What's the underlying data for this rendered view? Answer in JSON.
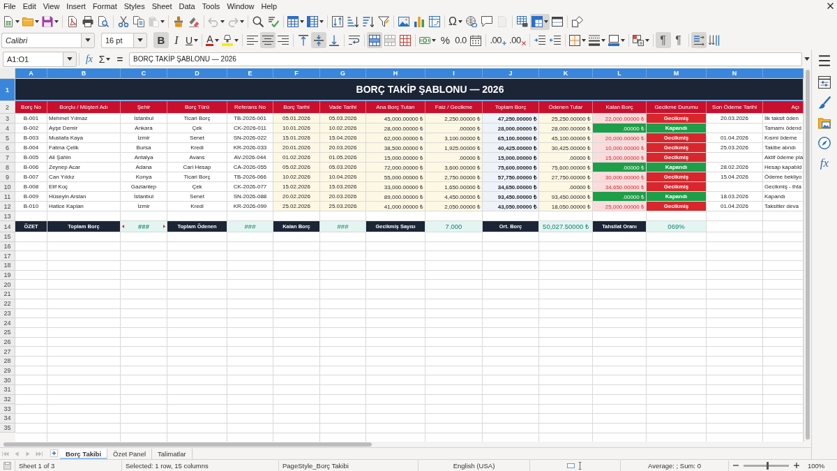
{
  "menu_bar": [
    "File",
    "Edit",
    "View",
    "Insert",
    "Format",
    "Styles",
    "Sheet",
    "Data",
    "Tools",
    "Window",
    "Help"
  ],
  "standard_toolbar": [
    [
      {
        "kind": "new",
        "dropdown": true,
        "disabled": false,
        "on": false
      },
      {
        "kind": "open",
        "dropdown": true,
        "disabled": false,
        "on": false
      },
      {
        "kind": "save",
        "dropdown": true,
        "disabled": false,
        "on": false
      }
    ],
    [
      {
        "kind": "export_pdf",
        "dropdown": false,
        "disabled": false,
        "on": false
      },
      {
        "kind": "print",
        "dropdown": false,
        "disabled": false,
        "on": false
      },
      {
        "kind": "print_preview",
        "dropdown": false,
        "disabled": false,
        "on": false
      }
    ],
    [
      {
        "kind": "cut",
        "dropdown": false,
        "disabled": false,
        "on": false
      },
      {
        "kind": "copy",
        "dropdown": false,
        "disabled": false,
        "on": false
      },
      {
        "kind": "paste",
        "dropdown": true,
        "disabled": true,
        "on": false
      }
    ],
    [
      {
        "kind": "clone_formatting",
        "dropdown": false,
        "disabled": false,
        "on": false
      },
      {
        "kind": "clear_formatting",
        "dropdown": false,
        "disabled": false,
        "on": false
      }
    ],
    [
      {
        "kind": "undo",
        "dropdown": true,
        "disabled": true,
        "on": false
      },
      {
        "kind": "redo",
        "dropdown": true,
        "disabled": true,
        "on": false
      }
    ],
    [
      {
        "kind": "find_replace",
        "dropdown": false,
        "disabled": false,
        "on": false
      },
      {
        "kind": "spelling",
        "dropdown": false,
        "disabled": false,
        "on": false
      }
    ],
    [
      {
        "kind": "rows",
        "dropdown": true,
        "disabled": false,
        "on": false
      },
      {
        "kind": "columns",
        "dropdown": true,
        "disabled": false,
        "on": false
      }
    ],
    [
      {
        "kind": "sort",
        "dropdown": false,
        "disabled": false,
        "on": false
      },
      {
        "kind": "sort_ascending",
        "dropdown": false,
        "disabled": false,
        "on": false
      },
      {
        "kind": "sort_descending",
        "dropdown": false,
        "disabled": false,
        "on": false
      },
      {
        "kind": "autofilter",
        "dropdown": false,
        "disabled": false,
        "on": false
      }
    ],
    [
      {
        "kind": "image",
        "dropdown": false,
        "disabled": false,
        "on": false
      },
      {
        "kind": "chart",
        "dropdown": false,
        "disabled": false,
        "on": false
      },
      {
        "kind": "pivot_table",
        "dropdown": false,
        "disabled": false,
        "on": false
      }
    ],
    [
      {
        "kind": "special_character",
        "label": "Ω",
        "dropdown": true,
        "disabled": false,
        "on": false
      },
      {
        "kind": "hyperlink",
        "dropdown": false,
        "disabled": false,
        "on": false
      },
      {
        "kind": "comment",
        "dropdown": false,
        "disabled": false,
        "on": false
      },
      {
        "kind": "header_footer",
        "dropdown": false,
        "disabled": true,
        "on": false
      }
    ],
    [
      {
        "kind": "print_area",
        "dropdown": false,
        "disabled": false,
        "on": false
      },
      {
        "kind": "freeze",
        "dropdown": true,
        "disabled": false,
        "on": true
      },
      {
        "kind": "split_window",
        "dropdown": false,
        "disabled": false,
        "on": false
      }
    ],
    [
      {
        "kind": "shapes",
        "dropdown": false,
        "disabled": false,
        "on": false
      }
    ]
  ],
  "formatting_toolbar": {
    "font_name": "Calibri",
    "font_size": "16 pt",
    "groups": [
      [
        {
          "kind": "bold",
          "label": "B",
          "on": true,
          "dropdown": false
        },
        {
          "kind": "italic",
          "label": "I",
          "on": false,
          "dropdown": false
        },
        {
          "kind": "underline",
          "label": "U",
          "on": false,
          "dropdown": true
        }
      ],
      [
        {
          "kind": "font_color",
          "label": "A",
          "on": false,
          "dropdown": true
        },
        {
          "kind": "highlight",
          "on": false,
          "dropdown": true
        }
      ],
      [
        {
          "kind": "align_left",
          "on": false,
          "dropdown": false
        },
        {
          "kind": "align_center",
          "on": true,
          "dropdown": false
        },
        {
          "kind": "align_right",
          "on": false,
          "dropdown": false
        }
      ],
      [
        {
          "kind": "align_top",
          "on": false,
          "dropdown": false
        },
        {
          "kind": "align_middle",
          "on": true,
          "dropdown": false
        },
        {
          "kind": "align_bottom",
          "on": false,
          "dropdown": false
        }
      ],
      [
        {
          "kind": "wrap_text",
          "on": false,
          "dropdown": false
        }
      ],
      [
        {
          "kind": "merge_center",
          "on": true,
          "dropdown": false
        },
        {
          "kind": "merge_cells",
          "on": false,
          "dropdown": false
        },
        {
          "kind": "unmerge_cells",
          "on": false,
          "dropdown": false
        }
      ],
      [
        {
          "kind": "currency",
          "on": false,
          "dropdown": true
        },
        {
          "kind": "percent",
          "label": "%",
          "on": false,
          "dropdown": false
        },
        {
          "kind": "number",
          "label": "0.0",
          "on": false,
          "dropdown": false
        },
        {
          "kind": "date",
          "on": false,
          "dropdown": false
        }
      ],
      [
        {
          "kind": "add_decimal",
          "label": ".00",
          "on": false,
          "dropdown": false
        },
        {
          "kind": "delete_decimal",
          "label": ".00",
          "on": false,
          "dropdown": false
        }
      ],
      [
        {
          "kind": "increase_indent",
          "on": false,
          "dropdown": false
        },
        {
          "kind": "decrease_indent",
          "on": false,
          "dropdown": false
        }
      ],
      [
        {
          "kind": "borders",
          "on": false,
          "dropdown": true
        },
        {
          "kind": "border_style",
          "on": false,
          "dropdown": true
        },
        {
          "kind": "border_color",
          "on": false,
          "dropdown": true
        }
      ],
      [
        {
          "kind": "conditional",
          "on": false,
          "dropdown": true
        }
      ],
      [
        {
          "kind": "ltr",
          "label": "¶",
          "on": true,
          "dropdown": false
        },
        {
          "kind": "rtl",
          "label": "¶",
          "on": false,
          "dropdown": false
        }
      ],
      [
        {
          "kind": "text_ltr",
          "on": true,
          "dropdown": false
        },
        {
          "kind": "text_ttb",
          "on": false,
          "dropdown": false
        }
      ]
    ]
  },
  "formula_bar": {
    "name_box": "A1:O1",
    "function_wizard": "fx",
    "sum": "Σ",
    "formula": "=",
    "content": "BORÇ TAKİP ŞABLONU — 2026"
  },
  "sidebar": [
    {
      "kind": "menu"
    },
    {
      "kind": "properties"
    },
    {
      "kind": "styles"
    },
    {
      "kind": "gallery"
    },
    {
      "kind": "navigator"
    },
    {
      "kind": "functions",
      "label": "fx"
    }
  ],
  "sheet": {
    "column_letters": [
      {
        "label": "A",
        "selected": true
      },
      {
        "label": "B",
        "selected": true
      },
      {
        "label": "C",
        "selected": true
      },
      {
        "label": "D",
        "selected": true
      },
      {
        "label": "E",
        "selected": true
      },
      {
        "label": "F",
        "selected": true
      },
      {
        "label": "G",
        "selected": true
      },
      {
        "label": "H",
        "selected": true
      },
      {
        "label": "I",
        "selected": true
      },
      {
        "label": "J",
        "selected": true
      },
      {
        "label": "K",
        "selected": true
      },
      {
        "label": "L",
        "selected": true
      },
      {
        "label": "M",
        "selected": true
      },
      {
        "label": "N",
        "selected": true
      },
      {
        "selected": true
      }
    ],
    "row_numbers": [
      {
        "label": "1",
        "selected": true
      },
      {
        "label": "2",
        "selected": false
      },
      {
        "label": "3",
        "selected": false
      },
      {
        "label": "4",
        "selected": false
      },
      {
        "label": "5",
        "selected": false
      },
      {
        "label": "6",
        "selected": false
      },
      {
        "label": "7",
        "selected": false
      },
      {
        "label": "8",
        "selected": false
      },
      {
        "label": "9",
        "selected": false
      },
      {
        "label": "10",
        "selected": false
      },
      {
        "label": "11",
        "selected": false
      },
      {
        "label": "12",
        "selected": false
      },
      {
        "label": "13",
        "selected": false
      },
      {
        "label": "14",
        "selected": false
      },
      {
        "label": "15",
        "selected": false
      },
      {
        "label": "16",
        "selected": false
      },
      {
        "label": "17",
        "selected": false
      },
      {
        "label": "18",
        "selected": false
      },
      {
        "label": "19",
        "selected": false
      },
      {
        "label": "20",
        "selected": false
      },
      {
        "label": "21",
        "selected": false
      },
      {
        "label": "22",
        "selected": false
      },
      {
        "label": "23",
        "selected": false
      },
      {
        "label": "24",
        "selected": false
      },
      {
        "label": "25",
        "selected": false
      },
      {
        "label": "26",
        "selected": false
      },
      {
        "label": "27",
        "selected": false
      },
      {
        "label": "28",
        "selected": false
      },
      {
        "label": "29",
        "selected": false
      },
      {
        "label": "30",
        "selected": false
      },
      {
        "label": "31",
        "selected": false
      },
      {
        "label": "32",
        "selected": false
      },
      {
        "label": "33",
        "selected": false
      },
      {
        "label": "34",
        "selected": false
      },
      {
        "label": "35",
        "selected": false
      }
    ],
    "title": "BORÇ TAKİP ŞABLONU — 2026",
    "headers": [
      "Borç No",
      "Borçlu / Müşteri Adı",
      "Şehir",
      "Borç Türü",
      "Referans No",
      "Borç Tarihi",
      "Vade Tarihi",
      "Ana Borç Tutarı",
      "Faiz / Gecikme",
      "Toplam Borç",
      "Ödenen Tutar",
      "Kalan Borç",
      "Gecikme Durumu",
      "Son Ödeme Tarihi",
      "Açı"
    ],
    "rows": [
      {
        "no": "B-001",
        "debtor": "Mehmet Yılmaz",
        "city": "İstanbul",
        "type": "Ticari Borç",
        "reference": "TB-2026-001",
        "debt_date": "05.01.2026",
        "due_date": "05.03.2026",
        "principal": "45,000.00000 ₺",
        "interest": "2,250.00000 ₺",
        "total": "47,250.00000 ₺",
        "paid": "25,250.00000 ₺",
        "remaining": "22,000.00000 ₺",
        "status": "Gecikmiş",
        "kind": "overdue",
        "last_payment": "20.03.2026",
        "note": "İlk taksit öden"
      },
      {
        "no": "B-002",
        "debtor": "Ayşe Demir",
        "city": "Ankara",
        "type": "Çek",
        "reference": "CK-2026-011",
        "debt_date": "10.01.2026",
        "due_date": "10.02.2026",
        "principal": "28,000.00000 ₺",
        "interest": ".00000 ₺",
        "total": "28,000.00000 ₺",
        "paid": "28,000.00000 ₺",
        "remaining": ".00000 ₺",
        "status": "Kapandı",
        "kind": "closed",
        "note": "Tamamı ödend"
      },
      {
        "no": "B-003",
        "debtor": "Mustafa Kaya",
        "city": "İzmir",
        "type": "Senet",
        "reference": "SN-2026-022",
        "debt_date": "15.01.2026",
        "due_date": "15.04.2026",
        "principal": "62,000.00000 ₺",
        "interest": "3,100.00000 ₺",
        "total": "65,100.00000 ₺",
        "paid": "45,100.00000 ₺",
        "remaining": "20,000.00000 ₺",
        "status": "Gecikmiş",
        "kind": "overdue",
        "last_payment": "01.04.2026",
        "note": "Kısmi ödeme"
      },
      {
        "no": "B-004",
        "debtor": "Fatma Çelik",
        "city": "Bursa",
        "type": "Kredi",
        "reference": "KR-2026-033",
        "debt_date": "20.01.2026",
        "due_date": "20.03.2026",
        "principal": "38,500.00000 ₺",
        "interest": "1,925.00000 ₺",
        "total": "40,425.00000 ₺",
        "paid": "30,425.00000 ₺",
        "remaining": "10,000.00000 ₺",
        "status": "Gecikmiş",
        "kind": "overdue",
        "last_payment": "25.03.2026",
        "note": "Takibe alındı"
      },
      {
        "no": "B-005",
        "debtor": "Ali Şahin",
        "city": "Antalya",
        "type": "Avans",
        "reference": "AV-2026-044",
        "debt_date": "01.02.2026",
        "due_date": "01.05.2026",
        "principal": "15,000.00000 ₺",
        "interest": ".00000 ₺",
        "total": "15,000.00000 ₺",
        "paid": ".00000 ₺",
        "remaining": "15,000.00000 ₺",
        "status": "Gecikmiş",
        "kind": "overdue",
        "note": "Aktif ödeme pla"
      },
      {
        "no": "B-006",
        "debtor": "Zeynep Acar",
        "city": "Adana",
        "type": "Cari Hesap",
        "reference": "CA-2026-055",
        "debt_date": "05.02.2026",
        "due_date": "05.03.2026",
        "principal": "72,000.00000 ₺",
        "interest": "3,600.00000 ₺",
        "total": "75,600.00000 ₺",
        "paid": "75,600.00000 ₺",
        "remaining": ".00000 ₺",
        "status": "Kapandı",
        "kind": "closed",
        "last_payment": "28.02.2026",
        "note": "Hesap kapatıld"
      },
      {
        "no": "B-007",
        "debtor": "Can Yıldız",
        "city": "Konya",
        "type": "Ticari Borç",
        "reference": "TB-2026-066",
        "debt_date": "10.02.2026",
        "due_date": "10.04.2026",
        "principal": "55,000.00000 ₺",
        "interest": "2,750.00000 ₺",
        "total": "57,750.00000 ₺",
        "paid": "27,750.00000 ₺",
        "remaining": "30,000.00000 ₺",
        "status": "Gecikmiş",
        "kind": "overdue",
        "last_payment": "15.04.2026",
        "note": "Ödeme bekliyo"
      },
      {
        "no": "B-008",
        "debtor": "Elif Koç",
        "city": "Gaziantep",
        "type": "Çek",
        "reference": "CK-2026-077",
        "debt_date": "15.02.2026",
        "due_date": "15.03.2026",
        "principal": "33,000.00000 ₺",
        "interest": "1,650.00000 ₺",
        "total": "34,650.00000 ₺",
        "paid": ".00000 ₺",
        "remaining": "34,650.00000 ₺",
        "status": "Gecikmiş",
        "kind": "overdue",
        "note": "Gecikmiş - ihta"
      },
      {
        "no": "B-009",
        "debtor": "Hüseyin Arslan",
        "city": "İstanbul",
        "type": "Senet",
        "reference": "SN-2026-088",
        "debt_date": "20.02.2026",
        "due_date": "20.03.2026",
        "principal": "89,000.00000 ₺",
        "interest": "4,450.00000 ₺",
        "total": "93,450.00000 ₺",
        "paid": "93,450.00000 ₺",
        "remaining": ".00000 ₺",
        "status": "Kapandı",
        "kind": "closed",
        "last_payment": "18.03.2026",
        "note": "Kapandı"
      },
      {
        "no": "B-010",
        "debtor": "Hatice Kaplan",
        "city": "İzmir",
        "type": "Kredi",
        "reference": "KR-2026-099",
        "debt_date": "25.02.2026",
        "due_date": "25.03.2026",
        "principal": "41,000.00000 ₺",
        "interest": "2,050.00000 ₺",
        "total": "43,050.00000 ₺",
        "paid": "18,050.00000 ₺",
        "remaining": "25,000.00000 ₺",
        "status": "Gecikmiş",
        "kind": "overdue",
        "last_payment": "01.04.2026",
        "note": "Taksitler deva"
      }
    ],
    "summary": [
      {
        "kind": "label",
        "text": "ÖZET"
      },
      {
        "kind": "label",
        "text": "Toplam Borç"
      },
      {
        "kind": "value",
        "text": "###",
        "overflow": true
      },
      {
        "kind": "label",
        "text": "Toplam Ödenen"
      },
      {
        "kind": "value",
        "text": "###",
        "overflow": false
      },
      {
        "kind": "label",
        "text": "Kalan Borç"
      },
      {
        "kind": "value",
        "text": "###",
        "overflow": false
      },
      {
        "kind": "label",
        "text": "Gecikmiş Sayısı"
      },
      {
        "kind": "value",
        "text": "7.000",
        "overflow": false
      },
      {
        "kind": "label",
        "text": "Ort. Borç"
      },
      {
        "kind": "value",
        "text": "50,027.50000 ₺",
        "overflow": false
      },
      {
        "kind": "label",
        "text": "Tahsilat Oranı"
      },
      {
        "kind": "value",
        "text": "069%",
        "overflow": false
      }
    ]
  },
  "sheet_tabs": {
    "navigation": [
      {
        "kind": "first",
        "disabled": true
      },
      {
        "kind": "previous",
        "disabled": true
      },
      {
        "kind": "next",
        "disabled": true
      },
      {
        "kind": "last",
        "disabled": true
      }
    ],
    "tabs": [
      {
        "label": "Borç Takibi",
        "selected": true
      },
      {
        "label": "Özet Panel",
        "selected": false
      },
      {
        "label": "Talimatlar",
        "selected": false
      }
    ]
  },
  "status_bar": {
    "sheet": "Sheet 1 of 3",
    "selection": "Selected: 1 row, 15 columns",
    "page_style": "PageStyle_Borç Takibi",
    "language": "English (USA)",
    "statistics": "Average: ; Sum: 0",
    "zoom_slider": {
      "level": 0.53
    },
    "zoom": "100%"
  }
}
